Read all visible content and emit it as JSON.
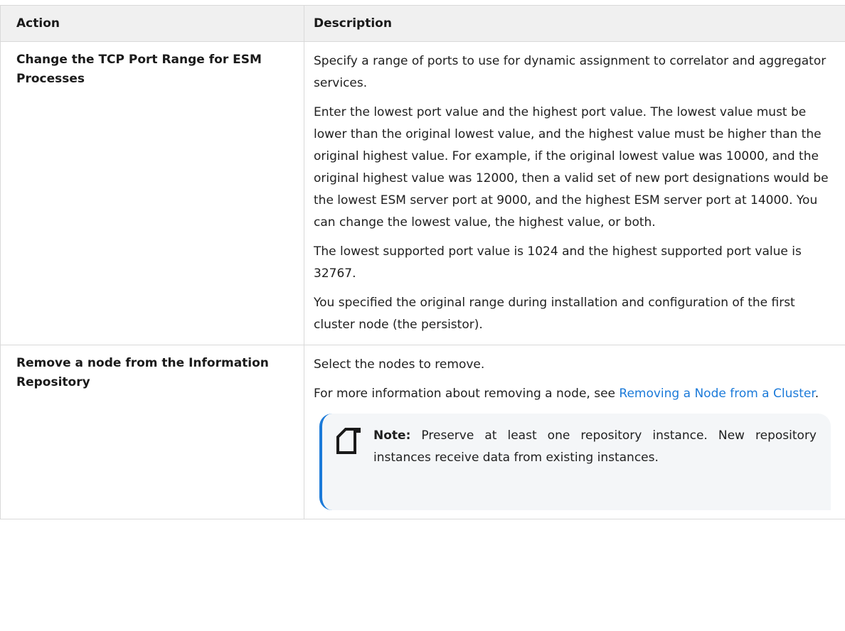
{
  "table": {
    "headers": {
      "action": "Action",
      "description": "Description"
    },
    "rows": [
      {
        "action": "Change the TCP Port Range for ESM Processes",
        "paragraphs": [
          "Specify a range of ports to use for dynamic assignment to correlator and aggregator services.",
          "Enter the lowest port value and the highest port value. The lowest value must be lower than the original lowest value, and the highest value must be higher than the original highest value. For example, if the original lowest value was 10000, and the original highest value was 12000, then a valid set of new port designations would be the lowest ESM server port at 9000, and the highest ESM server port at 14000. You can change the lowest value, the highest value, or both.",
          "The lowest supported port value is 1024 and the highest supported port value is 32767.",
          "You specified the original range during installation and configuration of the first cluster node (the persistor)."
        ]
      },
      {
        "action": "Remove a node from the Information Repository",
        "paragraphs": [
          "Select the nodes to remove."
        ],
        "more_info": {
          "prefix": "For more information about removing a node, see ",
          "link_text": "Removing a Node from a Cluster",
          "suffix": "."
        },
        "note": {
          "icon": "note-icon",
          "label": "Note:",
          "text": " Preserve at least one repository instance. New repository instances receive data from existing instances."
        }
      }
    ]
  },
  "colors": {
    "link": "#1b7ad9",
    "note_border": "#1b7ad9",
    "header_bg": "#f0f0f0"
  }
}
